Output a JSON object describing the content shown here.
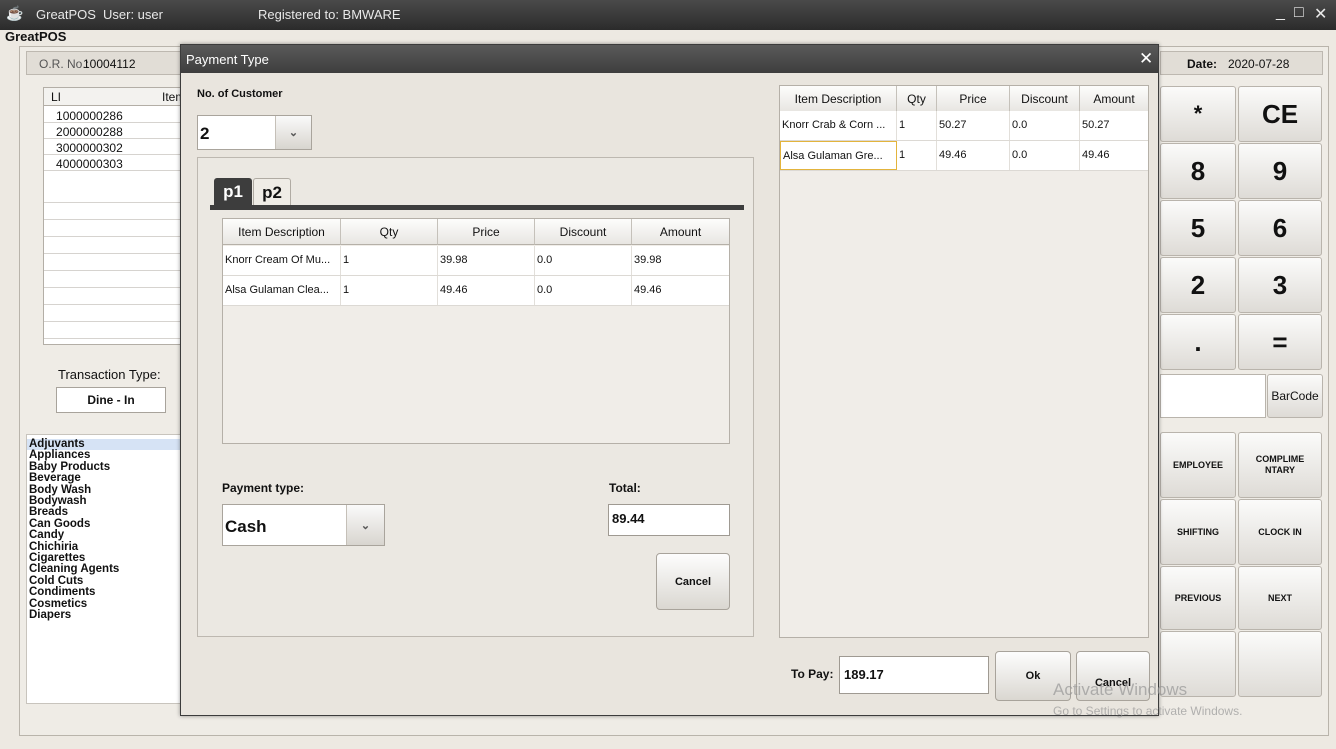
{
  "window": {
    "title": "GreatPOS",
    "user_label": "User: user",
    "registered": "Registered to: BMWARE",
    "minimize": "_",
    "maximize": "□",
    "close": "✕"
  },
  "app_title": "GreatPOS",
  "header": {
    "or_label": "O.R. No.:",
    "or_value": "10004112",
    "date_label": "Date:",
    "date_value": "2020-07-28"
  },
  "items_grid": {
    "col_li": "LI",
    "col_item": "Item",
    "rows": [
      {
        "li": "1",
        "code": "000000286"
      },
      {
        "li": "2",
        "code": "000000288"
      },
      {
        "li": "3",
        "code": "000000302"
      },
      {
        "li": "4",
        "code": "000000303"
      }
    ]
  },
  "transaction": {
    "label": "Transaction Type:",
    "value": "Dine - In"
  },
  "categories": [
    "Adjuvants",
    "Appliances",
    "Baby Products",
    "Beverage",
    "Body Wash",
    "Bodywash",
    "Breads",
    "Can Goods",
    "Candy",
    "Chichiria",
    "Cigarettes",
    "Cleaning Agents",
    "Cold Cuts",
    "Condiments",
    "Cosmetics",
    "Diapers"
  ],
  "selected_category": "Adjuvants",
  "keypad": {
    "star": "*",
    "ce": "CE",
    "k8": "8",
    "k9": "9",
    "k5": "5",
    "k6": "6",
    "k2": "2",
    "k3": "3",
    "dot": ".",
    "eq": "=",
    "barcode": "BarCode"
  },
  "func_buttons": {
    "employee": "EMPLOYEE",
    "compliment": "COMPLIME NTARY",
    "shifting": "SHIFTING",
    "clock_in": "CLOCK IN",
    "previous": "PREVIOUS",
    "next": "NEXT"
  },
  "watermark": {
    "line1": "Activate Windows",
    "line2": "Go to Settings to activate Windows."
  },
  "dialog": {
    "title": "Payment Type",
    "close": "✕",
    "customers_label": "No. of Customer",
    "customers_value": "2",
    "tabs": [
      "p1",
      "p2"
    ],
    "columns": [
      "Item Description",
      "Qty",
      "Price",
      "Discount",
      "Amount"
    ],
    "p1_rows": [
      {
        "desc": "Knorr Cream Of Mu...",
        "qty": "1",
        "price": "39.98",
        "discount": "0.0",
        "amount": "39.98"
      },
      {
        "desc": "Alsa Gulaman Clea...",
        "qty": "1",
        "price": "49.46",
        "discount": "0.0",
        "amount": "49.46"
      }
    ],
    "payment_type_label": "Payment type:",
    "payment_type_value": "Cash",
    "total_label": "Total:",
    "total_value": "89.44",
    "cancel_inner": "Cancel",
    "right_rows": [
      {
        "desc": "Knorr Crab & Corn ...",
        "qty": "1",
        "price": "50.27",
        "discount": "0.0",
        "amount": "50.27"
      },
      {
        "desc": "Alsa Gulaman Gre...",
        "qty": "1",
        "price": "49.46",
        "discount": "0.0",
        "amount": "49.46"
      }
    ],
    "to_pay_label": "To Pay:",
    "to_pay_value": "189.17",
    "ok": "Ok",
    "cancel": "Cancel"
  },
  "colors": {
    "titlebar": "#2b2b2b",
    "dialog_title": "#4a4a4a",
    "tab_active": "#3d3d3d",
    "selected_cell": "#e3b43c"
  }
}
